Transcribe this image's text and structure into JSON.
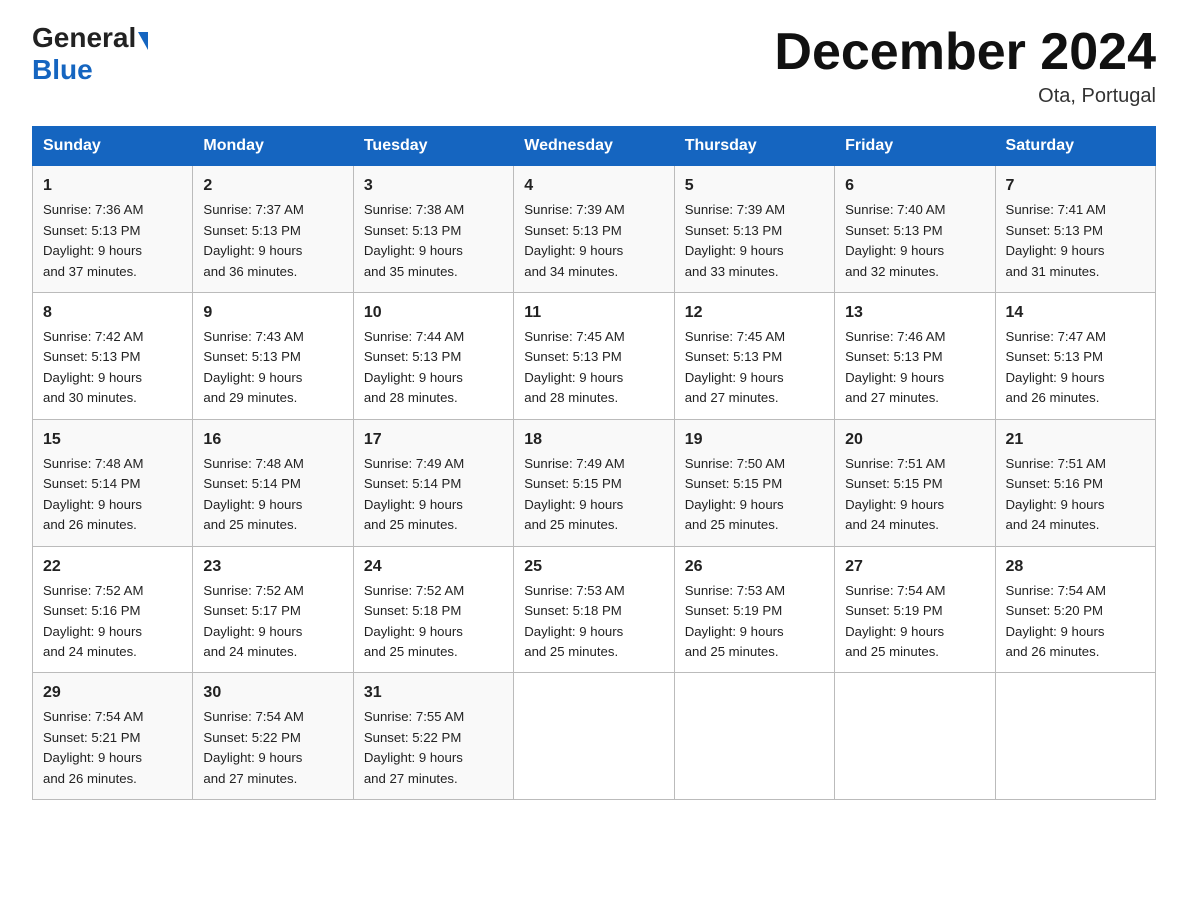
{
  "header": {
    "logo_general": "General",
    "logo_blue": "Blue",
    "title": "December 2024",
    "subtitle": "Ota, Portugal"
  },
  "columns": [
    "Sunday",
    "Monday",
    "Tuesday",
    "Wednesday",
    "Thursday",
    "Friday",
    "Saturday"
  ],
  "weeks": [
    [
      {
        "day": "1",
        "sunrise": "7:36 AM",
        "sunset": "5:13 PM",
        "daylight": "9 hours and 37 minutes."
      },
      {
        "day": "2",
        "sunrise": "7:37 AM",
        "sunset": "5:13 PM",
        "daylight": "9 hours and 36 minutes."
      },
      {
        "day": "3",
        "sunrise": "7:38 AM",
        "sunset": "5:13 PM",
        "daylight": "9 hours and 35 minutes."
      },
      {
        "day": "4",
        "sunrise": "7:39 AM",
        "sunset": "5:13 PM",
        "daylight": "9 hours and 34 minutes."
      },
      {
        "day": "5",
        "sunrise": "7:39 AM",
        "sunset": "5:13 PM",
        "daylight": "9 hours and 33 minutes."
      },
      {
        "day": "6",
        "sunrise": "7:40 AM",
        "sunset": "5:13 PM",
        "daylight": "9 hours and 32 minutes."
      },
      {
        "day": "7",
        "sunrise": "7:41 AM",
        "sunset": "5:13 PM",
        "daylight": "9 hours and 31 minutes."
      }
    ],
    [
      {
        "day": "8",
        "sunrise": "7:42 AM",
        "sunset": "5:13 PM",
        "daylight": "9 hours and 30 minutes."
      },
      {
        "day": "9",
        "sunrise": "7:43 AM",
        "sunset": "5:13 PM",
        "daylight": "9 hours and 29 minutes."
      },
      {
        "day": "10",
        "sunrise": "7:44 AM",
        "sunset": "5:13 PM",
        "daylight": "9 hours and 28 minutes."
      },
      {
        "day": "11",
        "sunrise": "7:45 AM",
        "sunset": "5:13 PM",
        "daylight": "9 hours and 28 minutes."
      },
      {
        "day": "12",
        "sunrise": "7:45 AM",
        "sunset": "5:13 PM",
        "daylight": "9 hours and 27 minutes."
      },
      {
        "day": "13",
        "sunrise": "7:46 AM",
        "sunset": "5:13 PM",
        "daylight": "9 hours and 27 minutes."
      },
      {
        "day": "14",
        "sunrise": "7:47 AM",
        "sunset": "5:13 PM",
        "daylight": "9 hours and 26 minutes."
      }
    ],
    [
      {
        "day": "15",
        "sunrise": "7:48 AM",
        "sunset": "5:14 PM",
        "daylight": "9 hours and 26 minutes."
      },
      {
        "day": "16",
        "sunrise": "7:48 AM",
        "sunset": "5:14 PM",
        "daylight": "9 hours and 25 minutes."
      },
      {
        "day": "17",
        "sunrise": "7:49 AM",
        "sunset": "5:14 PM",
        "daylight": "9 hours and 25 minutes."
      },
      {
        "day": "18",
        "sunrise": "7:49 AM",
        "sunset": "5:15 PM",
        "daylight": "9 hours and 25 minutes."
      },
      {
        "day": "19",
        "sunrise": "7:50 AM",
        "sunset": "5:15 PM",
        "daylight": "9 hours and 25 minutes."
      },
      {
        "day": "20",
        "sunrise": "7:51 AM",
        "sunset": "5:15 PM",
        "daylight": "9 hours and 24 minutes."
      },
      {
        "day": "21",
        "sunrise": "7:51 AM",
        "sunset": "5:16 PM",
        "daylight": "9 hours and 24 minutes."
      }
    ],
    [
      {
        "day": "22",
        "sunrise": "7:52 AM",
        "sunset": "5:16 PM",
        "daylight": "9 hours and 24 minutes."
      },
      {
        "day": "23",
        "sunrise": "7:52 AM",
        "sunset": "5:17 PM",
        "daylight": "9 hours and 24 minutes."
      },
      {
        "day": "24",
        "sunrise": "7:52 AM",
        "sunset": "5:18 PM",
        "daylight": "9 hours and 25 minutes."
      },
      {
        "day": "25",
        "sunrise": "7:53 AM",
        "sunset": "5:18 PM",
        "daylight": "9 hours and 25 minutes."
      },
      {
        "day": "26",
        "sunrise": "7:53 AM",
        "sunset": "5:19 PM",
        "daylight": "9 hours and 25 minutes."
      },
      {
        "day": "27",
        "sunrise": "7:54 AM",
        "sunset": "5:19 PM",
        "daylight": "9 hours and 25 minutes."
      },
      {
        "day": "28",
        "sunrise": "7:54 AM",
        "sunset": "5:20 PM",
        "daylight": "9 hours and 26 minutes."
      }
    ],
    [
      {
        "day": "29",
        "sunrise": "7:54 AM",
        "sunset": "5:21 PM",
        "daylight": "9 hours and 26 minutes."
      },
      {
        "day": "30",
        "sunrise": "7:54 AM",
        "sunset": "5:22 PM",
        "daylight": "9 hours and 27 minutes."
      },
      {
        "day": "31",
        "sunrise": "7:55 AM",
        "sunset": "5:22 PM",
        "daylight": "9 hours and 27 minutes."
      },
      null,
      null,
      null,
      null
    ]
  ],
  "labels": {
    "sunrise": "Sunrise:",
    "sunset": "Sunset:",
    "daylight": "Daylight: 9 hours"
  }
}
